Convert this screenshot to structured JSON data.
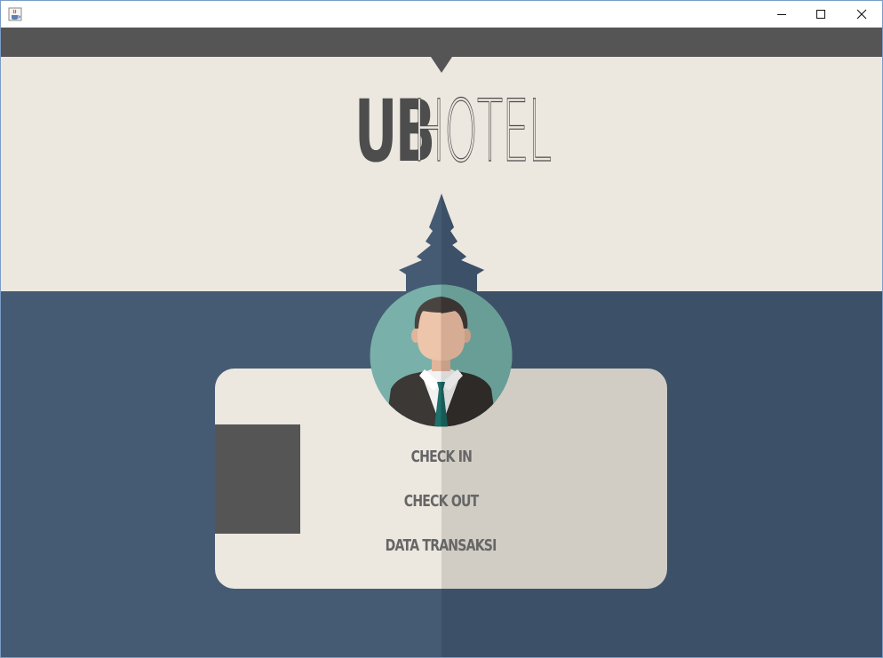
{
  "window": {
    "app_icon": "java-cup-icon",
    "controls": [
      "minimize-icon",
      "maximize-icon",
      "close-icon"
    ]
  },
  "logo": {
    "bold": "UB",
    "light": "HOTEL"
  },
  "menu": {
    "check_in": "CHECK IN",
    "check_out": "CHECK OUT",
    "data_transaksi": "DATA TRANSAKSI"
  },
  "colors": {
    "header_bg": "#ece7df",
    "top_bar": "#555555",
    "blue_left": "#455b73",
    "blue_right": "#3c5167",
    "card_left": "#ece7df",
    "card_right": "#d1cdc5",
    "avatar_bg": "#6aa8a0",
    "menu_text": "#666666"
  }
}
